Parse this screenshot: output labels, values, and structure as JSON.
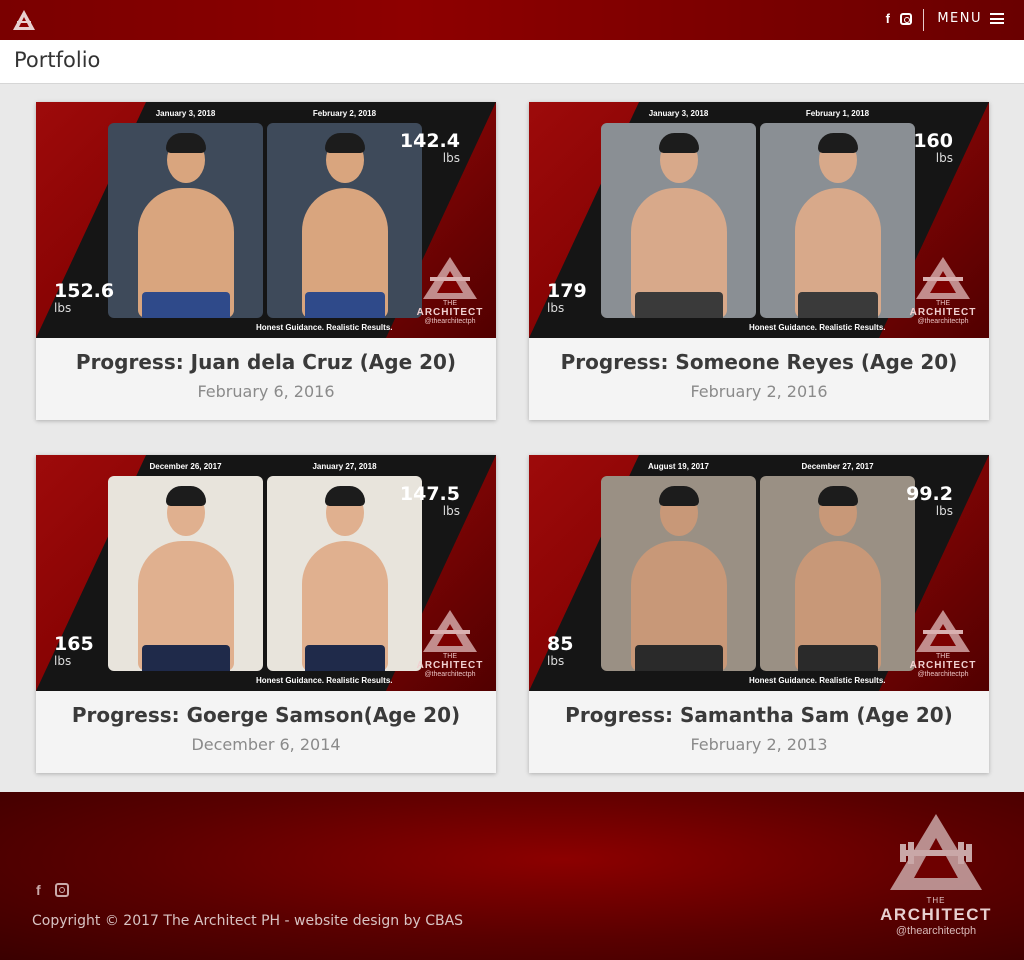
{
  "header": {
    "logo_icon": "architect-logo-icon",
    "social": [
      "facebook-icon",
      "instagram-icon"
    ],
    "facebook_glyph": "f",
    "menu_label": "MENU"
  },
  "page": {
    "title": "Portfolio"
  },
  "cards": [
    {
      "title": "Progress: Juan dela Cruz (Age 20)",
      "date": "February 6, 2016",
      "before_date": "January 3, 2018",
      "after_date": "February 2, 2018",
      "before_weight": "152.6",
      "after_weight": "142.4",
      "unit": "lbs"
    },
    {
      "title": "Progress: Someone Reyes (Age 20)",
      "date": "February 2, 2016",
      "before_date": "January 3, 2018",
      "after_date": "February 1, 2018",
      "before_weight": "179",
      "after_weight": "160",
      "unit": "lbs"
    },
    {
      "title": "Progress: Goerge Samson(Age 20)",
      "date": "December 6, 2014",
      "before_date": "December 26, 2017",
      "after_date": "January 27, 2018",
      "before_weight": "165",
      "after_weight": "147.5",
      "unit": "lbs"
    },
    {
      "title": "Progress: Samantha Sam (Age 20)",
      "date": "February 2, 2013",
      "before_date": "August 19, 2017",
      "after_date": "December 27, 2017",
      "before_weight": "85",
      "after_weight": "99.2",
      "unit": "lbs"
    }
  ],
  "image_brand": {
    "tagline": "Honest Guidance. Realistic Results.",
    "the": "THE",
    "word": "ARCHITECT",
    "handle": "@thearchitectph"
  },
  "footer": {
    "facebook_glyph": "f",
    "copyright": "Copyright © 2017 The Architect PH - website design by CBAS",
    "brand_the": "THE",
    "brand_word": "ARCHITECT",
    "brand_handle": "@thearchitectph"
  },
  "colors": {
    "brand_red": "#7d0000",
    "card_bg": "#f4f4f4",
    "page_bg": "#e9e9e9"
  }
}
